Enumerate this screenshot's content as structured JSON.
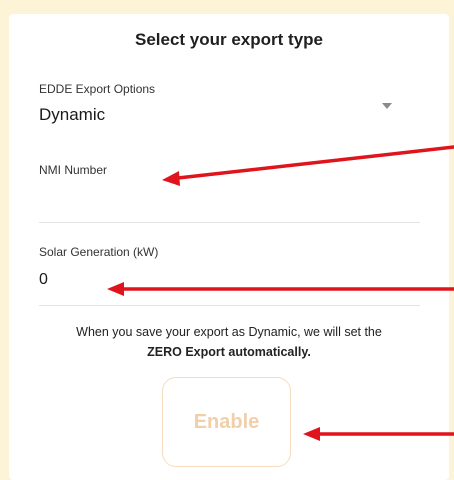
{
  "header": {
    "title": "Select your export type"
  },
  "export_options": {
    "label": "EDDE Export Options",
    "value": "Dynamic",
    "icon": "dropdown-arrow-icon"
  },
  "nmi": {
    "label": "NMI Number",
    "value": ""
  },
  "solar": {
    "label": "Solar Generation (kW)",
    "value": "0"
  },
  "notice": {
    "line1": "When you save your export as Dynamic, we will set the",
    "line2": "ZERO Export automatically."
  },
  "enable_button": {
    "label": "Enable"
  },
  "colors": {
    "background": "#fdf3d6",
    "annotation_arrow": "#e0141c",
    "button_text_disabled": "#f0cfa9",
    "button_border_disabled": "#f6dcbf"
  }
}
